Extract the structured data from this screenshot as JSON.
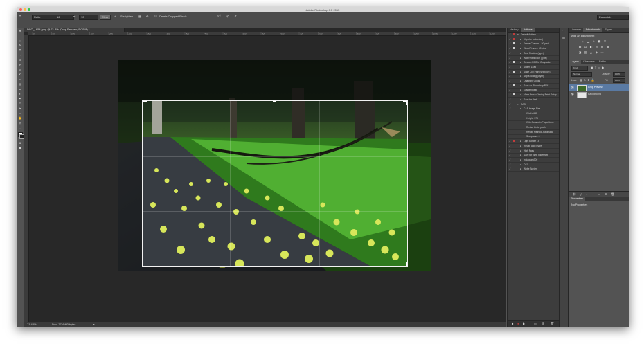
{
  "window": {
    "title": "Adobe Photoshop CC 2015"
  },
  "options_bar": {
    "ratio_value": "Ratio",
    "width_value": "16",
    "height_value": "10",
    "clear_label": "Clear",
    "straighten_label": "Straighten",
    "delete_cropped_label": "Delete Cropped Pixels",
    "workspace_value": "Essentials"
  },
  "document": {
    "tab_label": "DSC_1654.jpeg @ 71.4% (Crop Preview, RGB/8) *",
    "ruler_labels": [
      "0",
      "50",
      "100",
      "150",
      "200",
      "250",
      "300",
      "350",
      "400",
      "450",
      "500",
      "550",
      "600",
      "650",
      "700",
      "750",
      "800",
      "850",
      "900",
      "950",
      "1000",
      "1050",
      "1100",
      "1150",
      "1200"
    ],
    "zoom": "71.43%",
    "doc_info": "Doc: 77.4M/0 bytes"
  },
  "actions_panel": {
    "tabs": [
      "History",
      "Actions"
    ],
    "items": [
      {
        "name": "Default Actions",
        "checked": true,
        "dialog": "#c23c3c",
        "level": 0,
        "open": true
      },
      {
        "name": "Vignette (selection)",
        "checked": true,
        "dialog": "#c23c3c",
        "level": 1
      },
      {
        "name": "Frame Channel - 50 pixel",
        "checked": true,
        "dialog": "#cfcfcf",
        "level": 1
      },
      {
        "name": "Wood Frame - 50 pixel",
        "checked": true,
        "dialog": "#cfcfcf",
        "level": 1
      },
      {
        "name": "Cast Shadow (type)",
        "checked": true,
        "dialog": "",
        "level": 1
      },
      {
        "name": "Water Reflection (type)",
        "checked": true,
        "dialog": "",
        "level": 1
      },
      {
        "name": "Custom RGB to Grayscale",
        "checked": true,
        "dialog": "#cfcfcf",
        "level": 1
      },
      {
        "name": "Molten Lead",
        "checked": true,
        "dialog": "",
        "level": 1
      },
      {
        "name": "Make Clip Path (selection)",
        "checked": true,
        "dialog": "#cfcfcf",
        "level": 1
      },
      {
        "name": "Sepia Toning (layer)",
        "checked": true,
        "dialog": "",
        "level": 1
      },
      {
        "name": "Quadrant Colors",
        "checked": true,
        "dialog": "",
        "level": 1
      },
      {
        "name": "Save As Photoshop PDF",
        "checked": true,
        "dialog": "#cfcfcf",
        "level": 1
      },
      {
        "name": "Gradient Map",
        "checked": true,
        "dialog": "",
        "level": 1
      },
      {
        "name": "Mixer Brush Cloning Paint Setup",
        "checked": true,
        "dialog": "#cfcfcf",
        "level": 1
      },
      {
        "name": "Save for Web",
        "checked": true,
        "dialog": "",
        "level": 1
      },
      {
        "name": "CAS",
        "checked": true,
        "dialog": "",
        "level": 0,
        "open": true
      },
      {
        "name": "CAS Image Size",
        "checked": true,
        "dialog": "",
        "level": 1,
        "open": true
      },
      {
        "name": "Width: 640",
        "checked": false,
        "dialog": "",
        "level": 2
      },
      {
        "name": "Height: 373",
        "checked": false,
        "dialog": "",
        "level": 2
      },
      {
        "name": "With Constrain Proportions",
        "checked": false,
        "dialog": "",
        "level": 2
      },
      {
        "name": "Resize Units: pixels",
        "checked": false,
        "dialog": "",
        "level": 2
      },
      {
        "name": "Resize Method: Automatic",
        "checked": false,
        "dialog": "",
        "level": 2
      },
      {
        "name": "Sharpness: 0",
        "checked": false,
        "dialog": "",
        "level": 2
      },
      {
        "name": "Light Border 15",
        "checked": true,
        "dialog": "#c23c3c",
        "level": 1
      },
      {
        "name": "Resize and Share",
        "checked": true,
        "dialog": "",
        "level": 1
      },
      {
        "name": "High Pass",
        "checked": true,
        "dialog": "",
        "level": 1
      },
      {
        "name": "Save for Web Slideshow",
        "checked": true,
        "dialog": "",
        "level": 1
      },
      {
        "name": "Instagram300",
        "checked": true,
        "dialog": "",
        "level": 1
      },
      {
        "name": "CCC",
        "checked": true,
        "dialog": "",
        "level": 1
      },
      {
        "name": "White Border",
        "checked": true,
        "dialog": "",
        "level": 1
      }
    ]
  },
  "right_panel": {
    "top_tabs": [
      "Libraries",
      "Adjustments",
      "Styles"
    ],
    "adjustments_heading": "Add an adjustment",
    "layer_tabs": [
      "Layers",
      "Channels",
      "Paths"
    ],
    "kind_filter": "Kind",
    "blend_mode": "Normal",
    "opacity_label": "Opacity:",
    "opacity_value": "100%",
    "lock_label": "Lock:",
    "fill_label": "Fill:",
    "fill_value": "100%",
    "layers": [
      {
        "name": "Crop Preview",
        "selected": true
      },
      {
        "name": "Background",
        "selected": false
      }
    ],
    "properties_tab": "Properties",
    "properties_text": "No Properties"
  },
  "colors": {
    "app_dark": "#282828",
    "panel": "#535353",
    "selected_layer": "#5a7aa3",
    "record_red": "#c23c3c"
  }
}
